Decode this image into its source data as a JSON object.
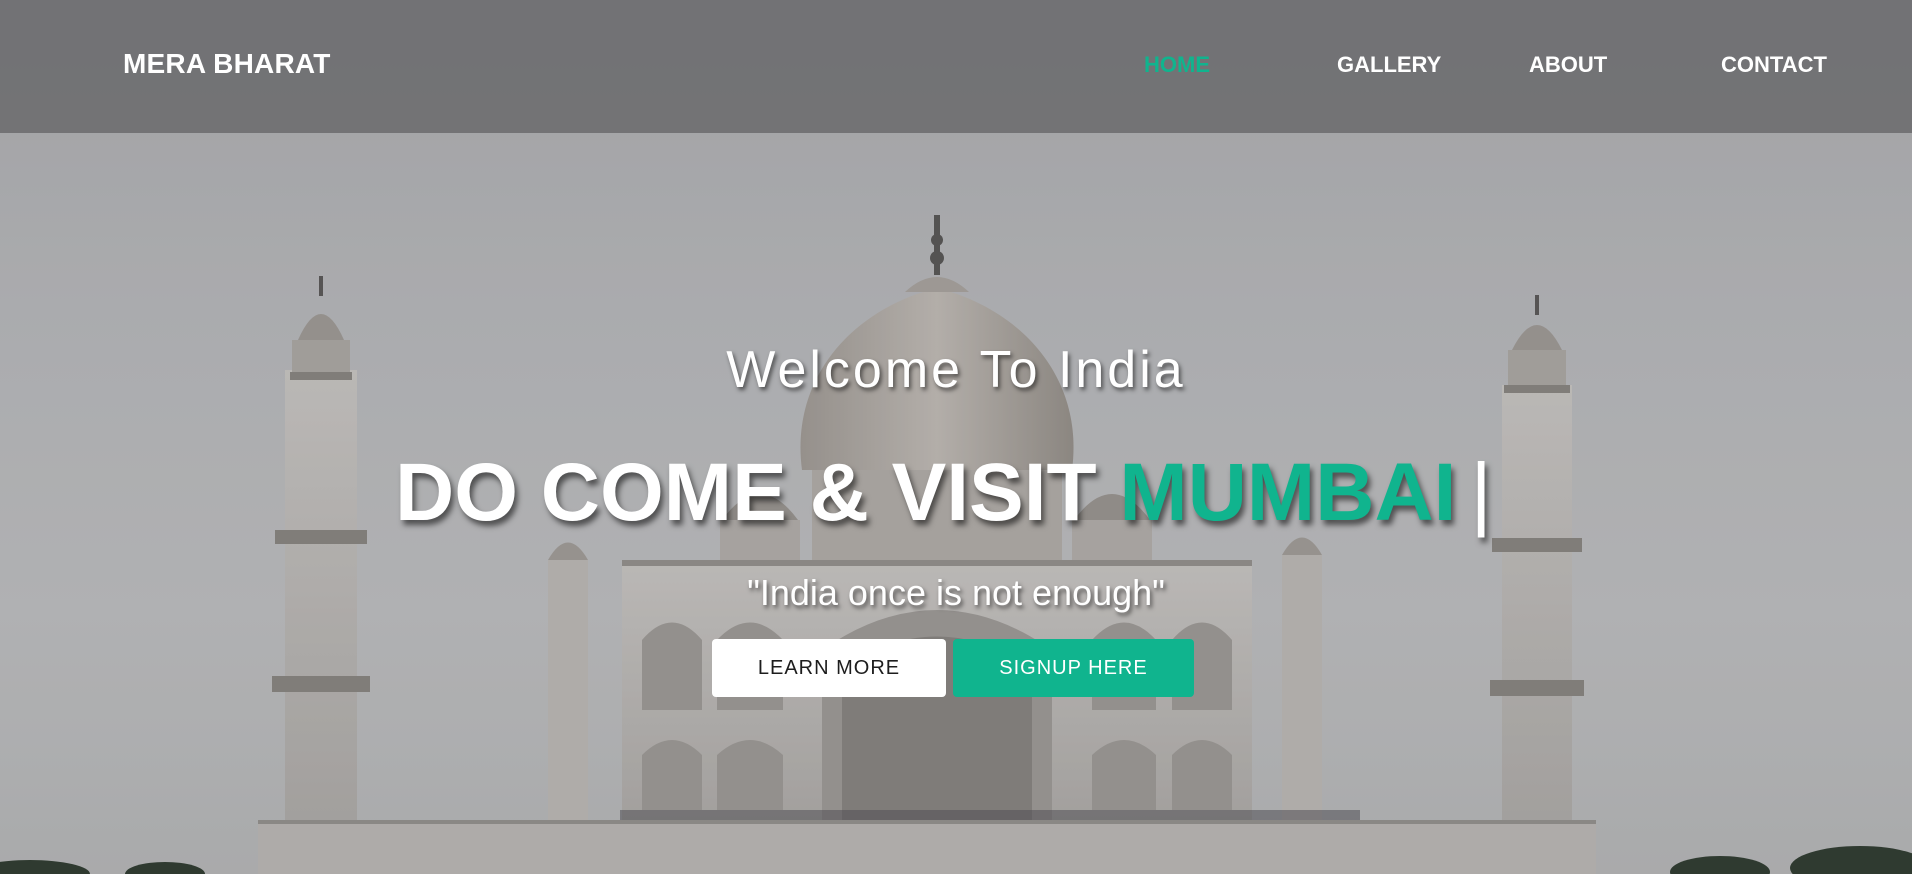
{
  "colors": {
    "accent": "#10b48e",
    "navbar_bg": "#68686a",
    "text": "#ffffff"
  },
  "navbar": {
    "brand": "MERA BHARAT",
    "links": [
      {
        "label": "HOME",
        "active": true
      },
      {
        "label": "GALLERY",
        "active": false
      },
      {
        "label": "ABOUT",
        "active": false
      },
      {
        "label": "CONTACT",
        "active": false
      }
    ]
  },
  "hero": {
    "background_icon": "taj-mahal-photo",
    "welcome": "Welcome To India",
    "headline_prefix": "DO COME & VISIT",
    "headline_highlight": "MUMBAI",
    "headline_cursor": "|",
    "quote": "\"India once is not enough\"",
    "buttons": {
      "learn_more": "LEARN MORE",
      "signup": "SIGNUP HERE"
    }
  }
}
